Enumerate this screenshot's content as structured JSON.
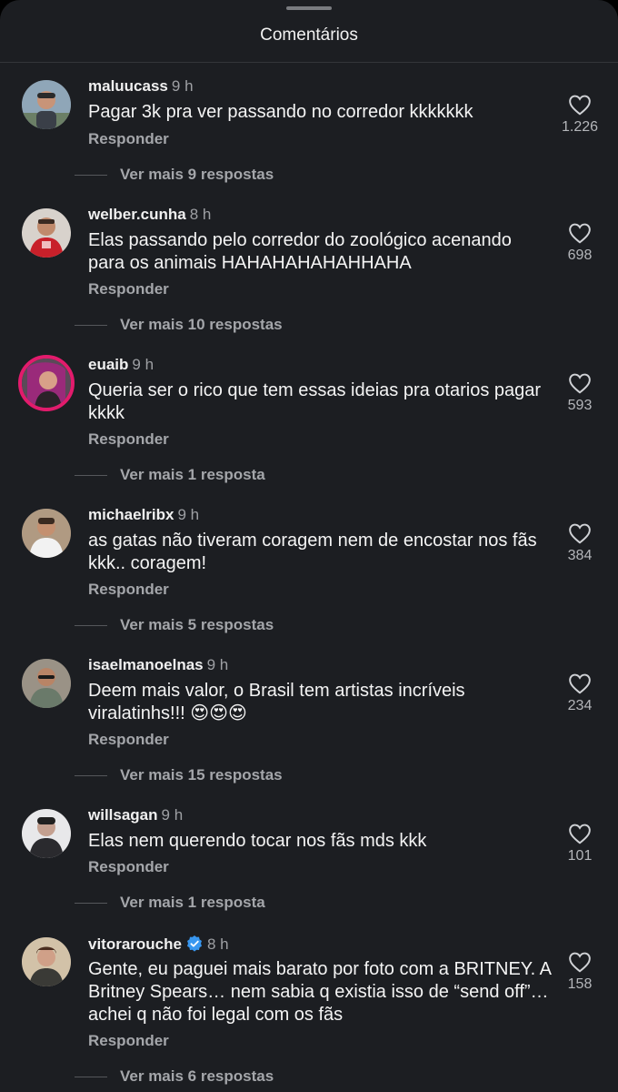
{
  "header": {
    "title": "Comentários"
  },
  "comments": [
    {
      "username": "maluucass",
      "time": "9 h",
      "text": "Pagar 3k pra ver passando no corredor kkkkkkk",
      "reply": "Responder",
      "likes": "1.226",
      "more": "Ver mais 9 respostas"
    },
    {
      "username": "welber.cunha",
      "time": "8 h",
      "text": "Elas passando pelo corredor do zoológico acenando para os animais HAHAHAHAHAHHAHA",
      "reply": "Responder",
      "likes": "698",
      "more": "Ver mais 10 respostas"
    },
    {
      "username": "euaib",
      "time": "9 h",
      "text": "Queria ser o rico que tem essas ideias pra otarios pagar kkkk",
      "reply": "Responder",
      "likes": "593",
      "more": "Ver mais 1 resposta"
    },
    {
      "username": "michaelribx",
      "time": "9 h",
      "text": "as gatas não tiveram coragem nem de encostar nos fãs kkk.. coragem!",
      "reply": "Responder",
      "likes": "384",
      "more": "Ver mais 5 respostas"
    },
    {
      "username": "isaelmanoelnas",
      "time": "9 h",
      "text": "Deem mais valor, o Brasil tem artistas incríveis viralatinhs!!! 😍😍😍",
      "reply": "Responder",
      "likes": "234",
      "more": "Ver mais 15 respostas"
    },
    {
      "username": "willsagan",
      "time": "9 h",
      "text": "Elas nem querendo tocar nos fãs mds kkk",
      "reply": "Responder",
      "likes": "101",
      "more": "Ver mais 1 resposta"
    },
    {
      "username": "vitorarouche",
      "time": "8 h",
      "text": "Gente, eu paguei mais barato por foto com a BRITNEY. A Britney Spears… nem sabia q existia isso de “send off”… achei q não foi legal com os fãs",
      "reply": "Responder",
      "likes": "158",
      "more": "Ver mais 6 respostas"
    }
  ],
  "colors": {
    "background": "#1c1e22",
    "story_ring": "#e21b6c",
    "verified": "#3897f0"
  }
}
